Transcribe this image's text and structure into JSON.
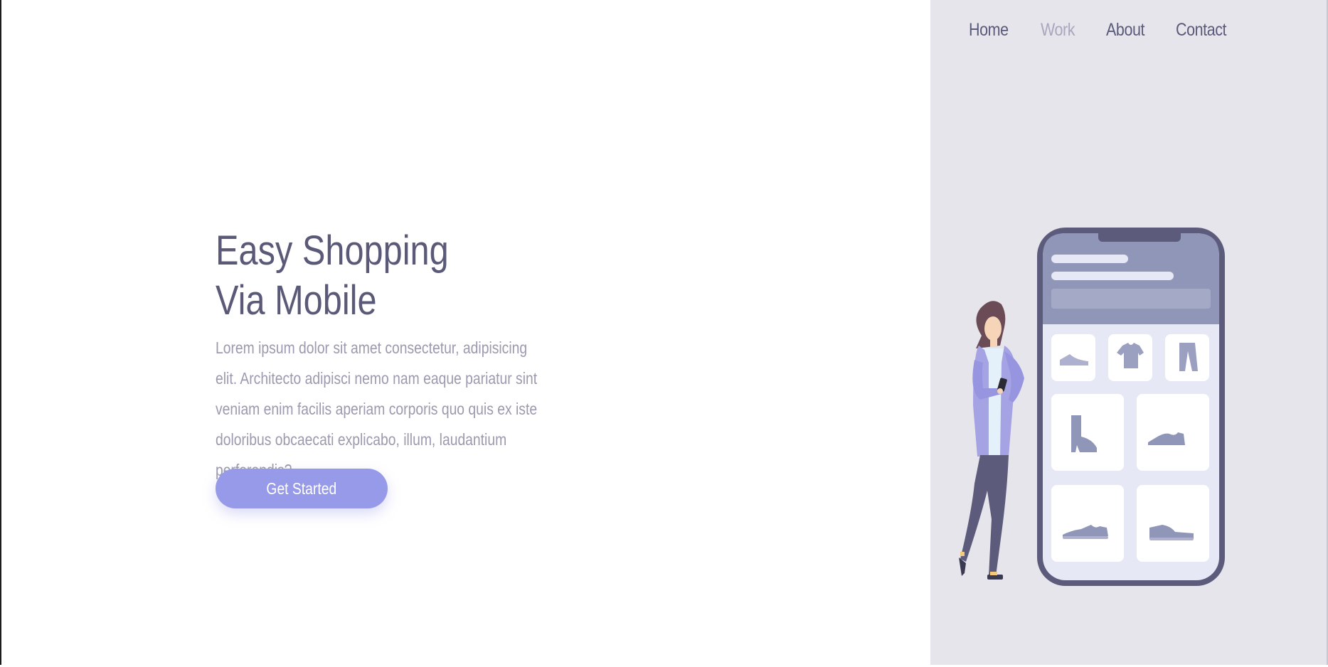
{
  "nav": {
    "items": [
      {
        "label": "Home",
        "active": false
      },
      {
        "label": "Work",
        "active": true
      },
      {
        "label": "About",
        "active": false
      },
      {
        "label": "Contact",
        "active": false
      }
    ]
  },
  "hero": {
    "title_line1": "Easy Shopping",
    "title_line2": "Via Mobile",
    "description": "Lorem ipsum dolor sit amet consectetur, adipisicing elit. Architecto adipisci nemo nam eaque pariatur sint veniam enim facilis aperiam corporis quo quis ex iste doloribus obcaecati explicabo, illum, laudantium perferendis?",
    "cta_label": "Get Started"
  },
  "colors": {
    "accent": "#979ae8",
    "title": "#5a5a78",
    "body_text": "#9b9aae",
    "panel_bg": "#e6e5ec",
    "nav_active": "#a8a7bd"
  },
  "illustration": {
    "icons": [
      "flat-shoe-icon",
      "tshirt-icon",
      "pants-icon",
      "boot-icon",
      "sneaker-icon",
      "sneaker-icon",
      "sneaker-icon"
    ]
  }
}
